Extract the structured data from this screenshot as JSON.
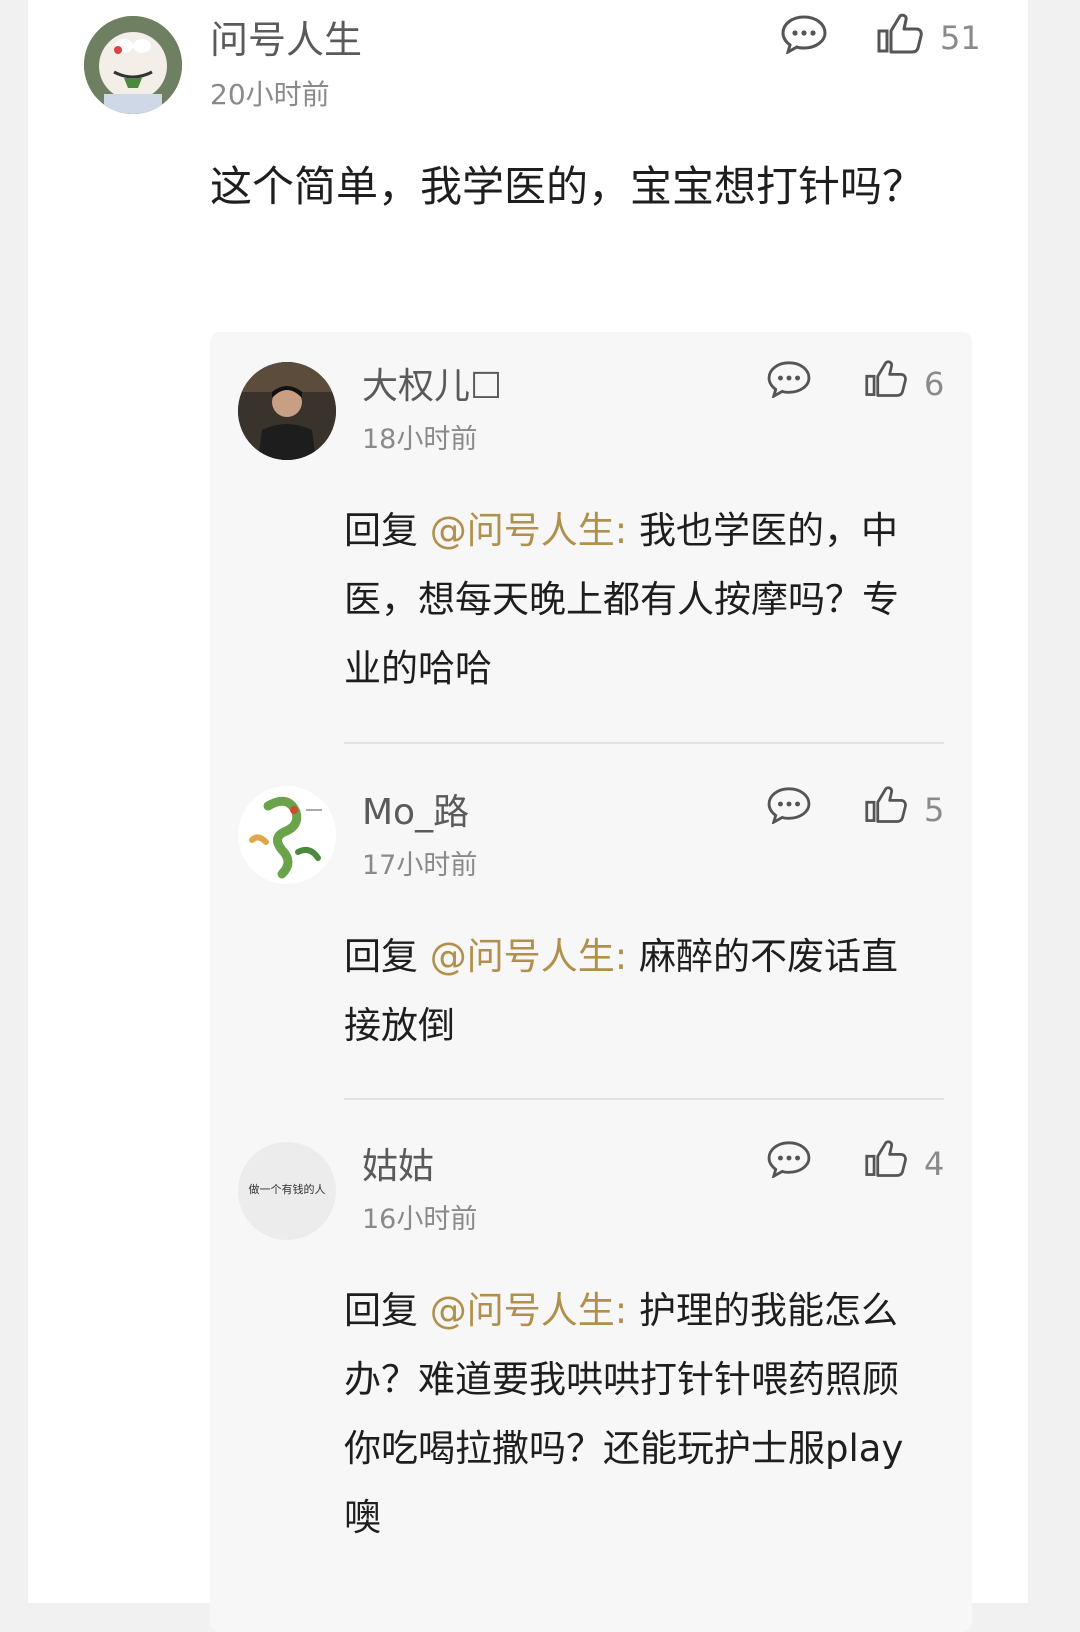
{
  "main_comment": {
    "author": "问号人生",
    "time": "20小时前",
    "likes": "51",
    "text": "这个简单，我学医的，宝宝想打针吗？"
  },
  "replies": [
    {
      "author": "大权儿☐",
      "time": "18小时前",
      "likes": "6",
      "prefix": "回复 ",
      "mention": "@问号人生:",
      "text": " 我也学医的，中医，想每天晚上都有人按摩吗？专业的哈哈"
    },
    {
      "author": "Mo_路",
      "time": "17小时前",
      "likes": "5",
      "prefix": "回复 ",
      "mention": "@问号人生:",
      "text": " 麻醉的不废话直接放倒"
    },
    {
      "author": "姑姑",
      "time": "16小时前",
      "likes": "4",
      "avatar_text": "做一个有钱的人",
      "prefix": "回复 ",
      "mention": "@问号人生:",
      "text": " 护理的我能怎么办？难道要我哄哄打针针喂药照顾你吃喝拉撒吗？还能玩护士服play噢"
    }
  ],
  "colors": {
    "mention": "#b1904c",
    "reply_background": "#f7f7f7",
    "page_background": "#f1f1f1"
  },
  "icons": {
    "comment": "comment-bubble-icon",
    "like": "thumbs-up-icon"
  }
}
